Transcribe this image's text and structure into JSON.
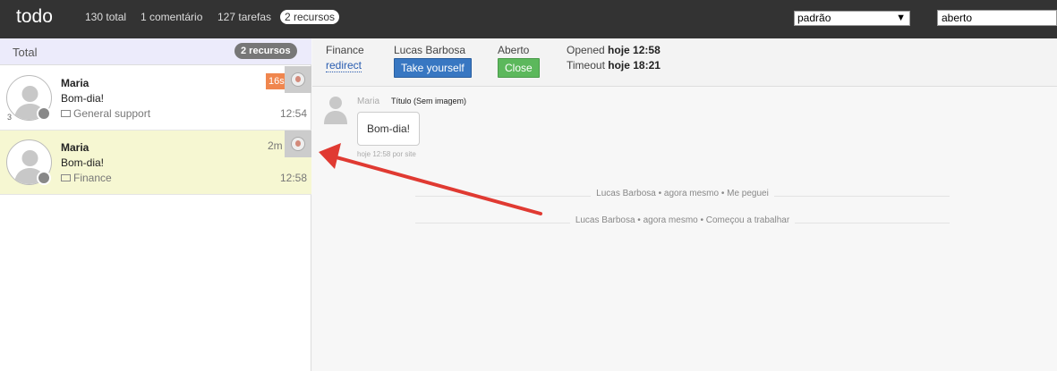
{
  "topbar": {
    "brand": "todo",
    "nav": [
      "130 total",
      "1 comentário",
      "127 tarefas",
      "2 recursos"
    ],
    "select_value": "padrão",
    "search_value": "aberto"
  },
  "left": {
    "header_title": "Total",
    "header_badge": "2 recursos",
    "conversations": [
      {
        "count": "3",
        "name": "Maria",
        "message": "Bom-dia!",
        "department": "General support",
        "time": "12:54",
        "timer": "16s"
      },
      {
        "count": "",
        "name": "Maria",
        "message": "Bom-dia!",
        "department": "Finance",
        "time": "12:58",
        "timer": "2m"
      }
    ]
  },
  "detail": {
    "dept_label": "Finance",
    "dept_link": "redirect",
    "agent_label": "Lucas Barbosa",
    "agent_button": "Take yourself",
    "status_label": "Aberto",
    "status_button": "Close",
    "opened_label": "Opened",
    "opened_value": "hoje 12:58",
    "timeout_label": "Timeout",
    "timeout_value": "hoje 18:21"
  },
  "chat": {
    "author": "Maria",
    "title": "Título (Sem imagem)",
    "bubble": "Bom-dia!",
    "meta": "hoje 12:58 por site",
    "events": [
      "Lucas Barbosa • agora mesmo • Me peguei",
      "Lucas Barbosa • agora mesmo • Começou a trabalhar"
    ]
  },
  "colors": {
    "topbar": "#333333",
    "active_row": "#f6f7d2",
    "timer_badge": "#f0864e",
    "take_button": "#3877c2",
    "close_button": "#5cb85c",
    "annotation_arrow": "#e03a32"
  }
}
